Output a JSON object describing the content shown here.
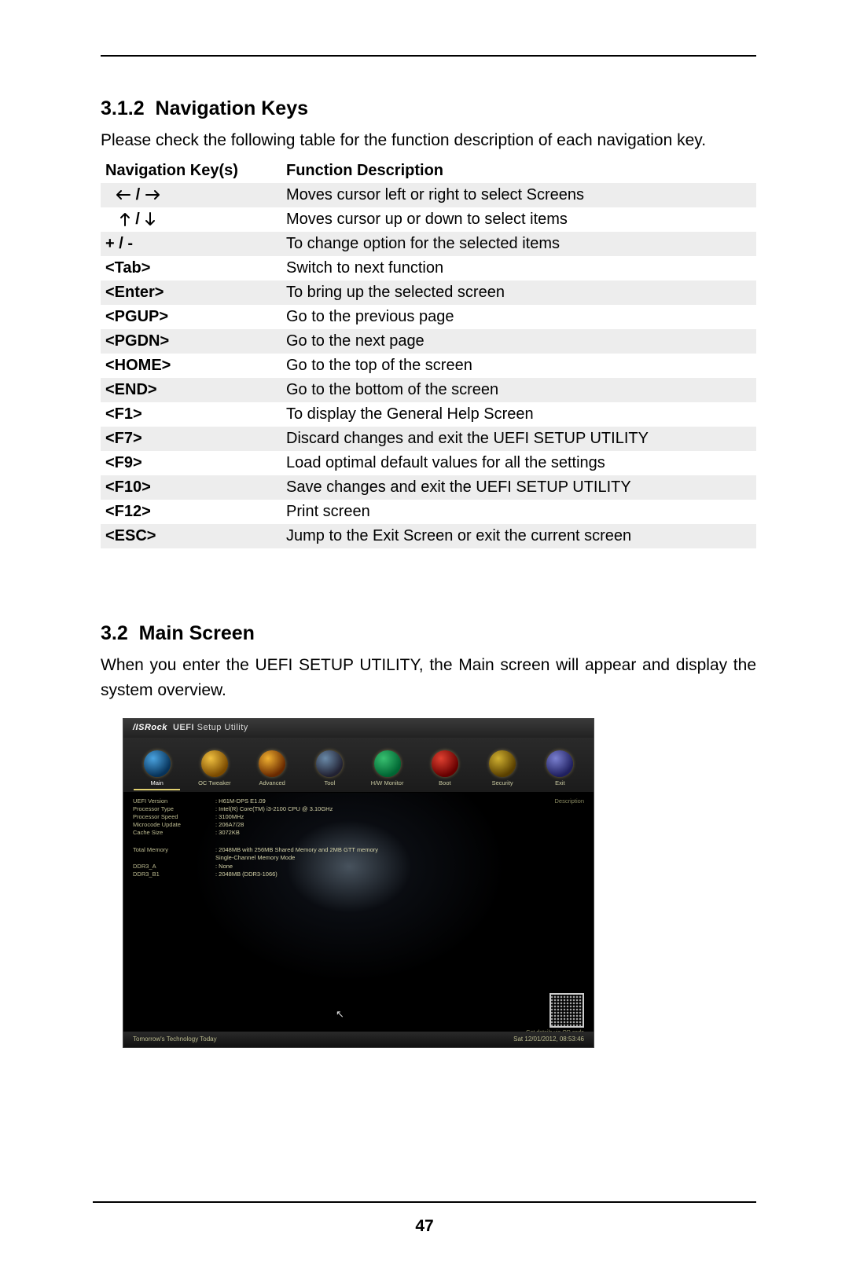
{
  "section1": {
    "number": "3.1.2",
    "title": "Navigation Keys",
    "intro": "Please check the following table for the function description of each navigation key."
  },
  "table": {
    "head_key": "Navigation Key(s)",
    "head_desc": "Function Description",
    "rows": [
      {
        "key_type": "arrows-lr",
        "desc": "Moves cursor left or right to select Screens"
      },
      {
        "key_type": "arrows-ud",
        "desc": "Moves cursor up or down to select items"
      },
      {
        "key": "+  /  -",
        "desc": "To change option for the selected items"
      },
      {
        "key": "<Tab>",
        "desc": "Switch to next function"
      },
      {
        "key": "<Enter>",
        "desc": "To bring up the selected screen"
      },
      {
        "key": "<PGUP>",
        "desc": "Go to the previous page"
      },
      {
        "key": "<PGDN>",
        "desc": "Go to the next page"
      },
      {
        "key": "<HOME>",
        "desc": "Go to the top of the screen"
      },
      {
        "key": "<END>",
        "desc": "Go to the bottom of the screen"
      },
      {
        "key": "<F1>",
        "desc": "To display the General Help Screen"
      },
      {
        "key": "<F7>",
        "desc": "Discard changes and exit the UEFI SETUP UTILITY"
      },
      {
        "key": "<F9>",
        "desc": "Load optimal default values for all the settings"
      },
      {
        "key": "<F10>",
        "desc": "Save changes and exit the UEFI SETUP UTILITY"
      },
      {
        "key": "<F12>",
        "desc": "Print screen"
      },
      {
        "key": "<ESC>",
        "desc": "Jump to the Exit Screen or exit the current screen"
      }
    ]
  },
  "section2": {
    "number": "3.2",
    "title": "Main Screen",
    "intro": "When you enter the UEFI SETUP UTILITY, the Main screen will appear and display the system overview."
  },
  "uefi": {
    "brand": "/ISRock",
    "brand2": "UEFI",
    "brand3": "Setup Utility",
    "tabs": [
      "Main",
      "OC Tweaker",
      "Advanced",
      "Tool",
      "H/W Monitor",
      "Boot",
      "Security",
      "Exit"
    ],
    "info": [
      {
        "lbl": "UEFI Version",
        "val": ": H61M-DPS E1.09"
      },
      {
        "lbl": "Processor Type",
        "val": ": Intel(R) Core(TM) i3-2100 CPU @ 3.10GHz"
      },
      {
        "lbl": "Processor Speed",
        "val": ": 3100MHz"
      },
      {
        "lbl": "Microcode Update",
        "val": ": 206A7/28"
      },
      {
        "lbl": "Cache Size",
        "val": ": 3072KB"
      }
    ],
    "mem": [
      {
        "lbl": "Total Memory",
        "val": ": 2048MB with 256MB Shared Memory and 2MB GTT memory"
      },
      {
        "lbl": "",
        "val": "  Single-Channel Memory Mode"
      },
      {
        "lbl": "DDR3_A",
        "val": ": None"
      },
      {
        "lbl": "DDR3_B1",
        "val": ": 2048MB (DDR3-1066)"
      }
    ],
    "right_title": "Description",
    "qr_caption": "Get details via QR code",
    "footer_left": "Tomorrow's Technology Today",
    "footer_right": "Sat 12/01/2012, 08:53:46"
  },
  "page_number": "47"
}
